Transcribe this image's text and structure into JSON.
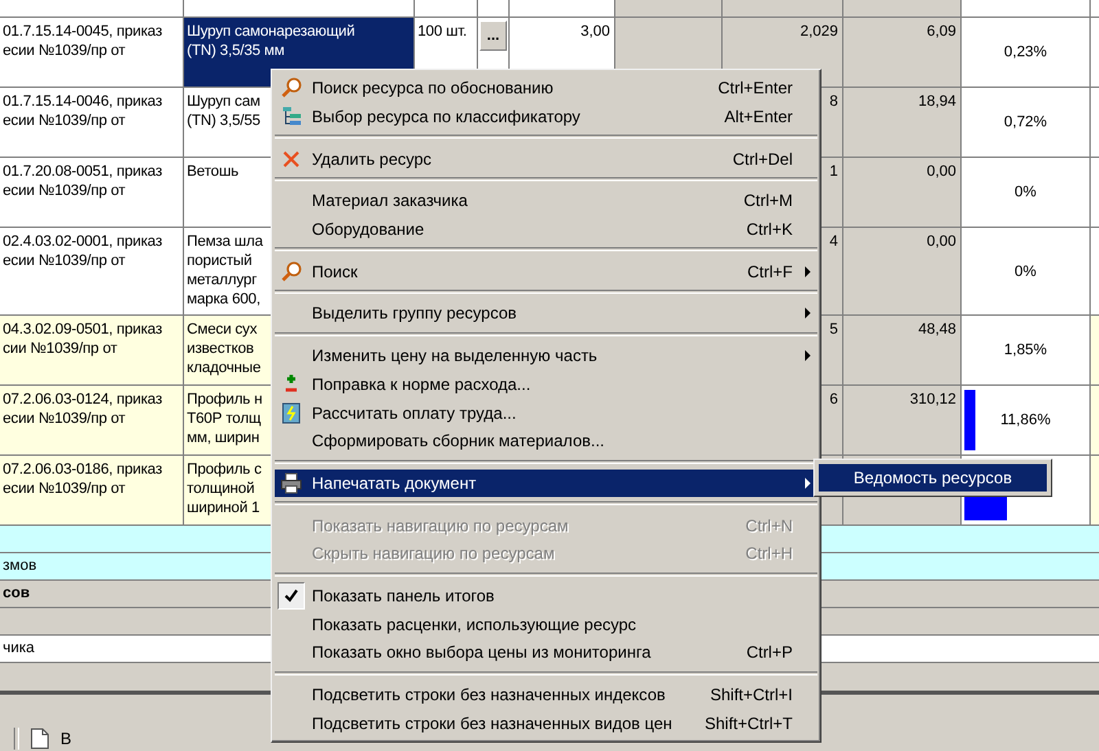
{
  "table": {
    "rows": [
      {
        "code": "01.7.15.14-0045, приказ\nесии №1039/пр от",
        "name": "Шуруп самонарезающий\n(TN) 3,5/35 мм",
        "selected": true,
        "highlighted": false,
        "unit": "100 шт.",
        "button": "...",
        "qty": "3,00",
        "col6": "2,029",
        "col7": "6,09",
        "percent": "0,23%"
      },
      {
        "code": "01.7.15.14-0046, приказ\nесии №1039/пр от",
        "name": "Шуруп сам\n(TN) 3,5/55",
        "selected": false,
        "highlighted": false,
        "col6": "8",
        "col7": "18,94",
        "percent": "0,72%"
      },
      {
        "code": "01.7.20.08-0051, приказ\nесии №1039/пр от",
        "name": "Ветошь",
        "selected": false,
        "highlighted": false,
        "col6": "1",
        "col7": "0,00",
        "percent": "0%"
      },
      {
        "code": "02.4.03.02-0001, приказ\nесии №1039/пр от",
        "name": "Пемза шла\nпористый\nметаллург\nмарка 600,",
        "selected": false,
        "highlighted": false,
        "col6": "4",
        "col7": "0,00",
        "percent": "0%"
      },
      {
        "code": "04.3.02.09-0501, приказ\nсии №1039/пр от",
        "name": "Смеси сух\nизвестков\nкладочные",
        "selected": false,
        "highlighted": true,
        "col6": "5",
        "col7": "48,48",
        "percent": "1,85%"
      },
      {
        "code": "07.2.06.03-0124, приказ\nесии №1039/пр от",
        "name": "Профиль н\nТ60Р толщ\nмм, ширин",
        "selected": false,
        "highlighted": true,
        "col6": "6",
        "col7": "310,12",
        "percent": "11,86%",
        "level": 0.09
      },
      {
        "code": "07.2.06.03-0186, приказ\nесии №1039/пр от",
        "name": "Профиль с\nтолщиной\nшириной 1",
        "selected": false,
        "highlighted": true,
        "level": 0.33
      }
    ]
  },
  "panel_rows": [
    {
      "kind": "band"
    },
    {
      "kind": "band",
      "text": "змов"
    },
    {
      "kind": "bold",
      "text": "сов"
    },
    {
      "kind": "plain"
    },
    {
      "kind": "field",
      "text": "чика"
    },
    {
      "kind": "plain"
    }
  ],
  "bottom_bar": {
    "text": "В"
  },
  "context_menu": {
    "items": [
      {
        "kind": "item",
        "label": "Поиск ресурса по обоснованию",
        "shortcut": "Ctrl+Enter",
        "has_submenu": false,
        "disabled": false,
        "checked": false,
        "selected": false
      },
      {
        "kind": "item",
        "label": "Выбор ресурса по классификатору",
        "shortcut": "Alt+Enter",
        "has_submenu": false,
        "disabled": false,
        "checked": false,
        "selected": false
      },
      {
        "kind": "separator"
      },
      {
        "kind": "item",
        "label": "Удалить ресурс",
        "shortcut": "Ctrl+Del",
        "has_submenu": false,
        "disabled": false,
        "checked": false,
        "selected": false
      },
      {
        "kind": "separator"
      },
      {
        "kind": "item",
        "label": "Материал заказчика",
        "shortcut": "Ctrl+M",
        "has_submenu": false,
        "disabled": false,
        "checked": false,
        "selected": false
      },
      {
        "kind": "item",
        "label": "Оборудование",
        "shortcut": "Ctrl+K",
        "has_submenu": false,
        "disabled": false,
        "checked": false,
        "selected": false
      },
      {
        "kind": "separator"
      },
      {
        "kind": "item",
        "label": "Поиск",
        "shortcut": "Ctrl+F",
        "has_submenu": true,
        "disabled": false,
        "checked": false,
        "selected": false
      },
      {
        "kind": "separator"
      },
      {
        "kind": "item",
        "label": "Выделить группу ресурсов",
        "has_submenu": true,
        "disabled": false,
        "checked": false,
        "selected": false
      },
      {
        "kind": "separator"
      },
      {
        "kind": "item",
        "label": "Изменить цену на выделенную часть",
        "has_submenu": true,
        "disabled": false,
        "checked": false,
        "selected": false
      },
      {
        "kind": "item",
        "label": "Поправка к норме расхода...",
        "has_submenu": false,
        "disabled": false,
        "checked": false,
        "selected": false
      },
      {
        "kind": "item",
        "label": "Рассчитать оплату труда...",
        "has_submenu": false,
        "disabled": false,
        "checked": false,
        "selected": false
      },
      {
        "kind": "item",
        "label": "Сформировать сборник материалов...",
        "has_submenu": false,
        "disabled": false,
        "checked": false,
        "selected": false
      },
      {
        "kind": "separator"
      },
      {
        "kind": "item",
        "label": "Напечатать документ",
        "has_submenu": true,
        "disabled": false,
        "checked": false,
        "selected": true,
        "submenu": [
          {
            "label": "Ведомость ресурсов",
            "selected": true
          }
        ]
      },
      {
        "kind": "separator"
      },
      {
        "kind": "item",
        "label": "Показать навигацию по ресурсам",
        "shortcut": "Ctrl+N",
        "has_submenu": false,
        "disabled": true,
        "checked": false,
        "selected": false
      },
      {
        "kind": "item",
        "label": "Скрыть навигацию по ресурсам",
        "shortcut": "Ctrl+H",
        "has_submenu": false,
        "disabled": true,
        "checked": false,
        "selected": false
      },
      {
        "kind": "separator"
      },
      {
        "kind": "item",
        "label": "Показать панель итогов",
        "has_submenu": false,
        "disabled": false,
        "checked": true,
        "selected": false
      },
      {
        "kind": "item",
        "label": "Показать расценки, использующие ресурс",
        "has_submenu": false,
        "disabled": false,
        "checked": false,
        "selected": false
      },
      {
        "kind": "item",
        "label": "Показать окно выбора цены из мониторинга",
        "shortcut": "Ctrl+P",
        "has_submenu": false,
        "disabled": false,
        "checked": false,
        "selected": false
      },
      {
        "kind": "separator"
      },
      {
        "kind": "item",
        "label": "Подсветить строки без назначенных индексов",
        "shortcut": "Shift+Ctrl+I",
        "has_submenu": false,
        "disabled": false,
        "checked": false,
        "selected": false
      },
      {
        "kind": "item",
        "label": "Подсветить строки без назначенных видов цен",
        "shortcut": "Shift+Ctrl+T",
        "has_submenu": false,
        "disabled": false,
        "checked": false,
        "selected": false
      }
    ]
  }
}
